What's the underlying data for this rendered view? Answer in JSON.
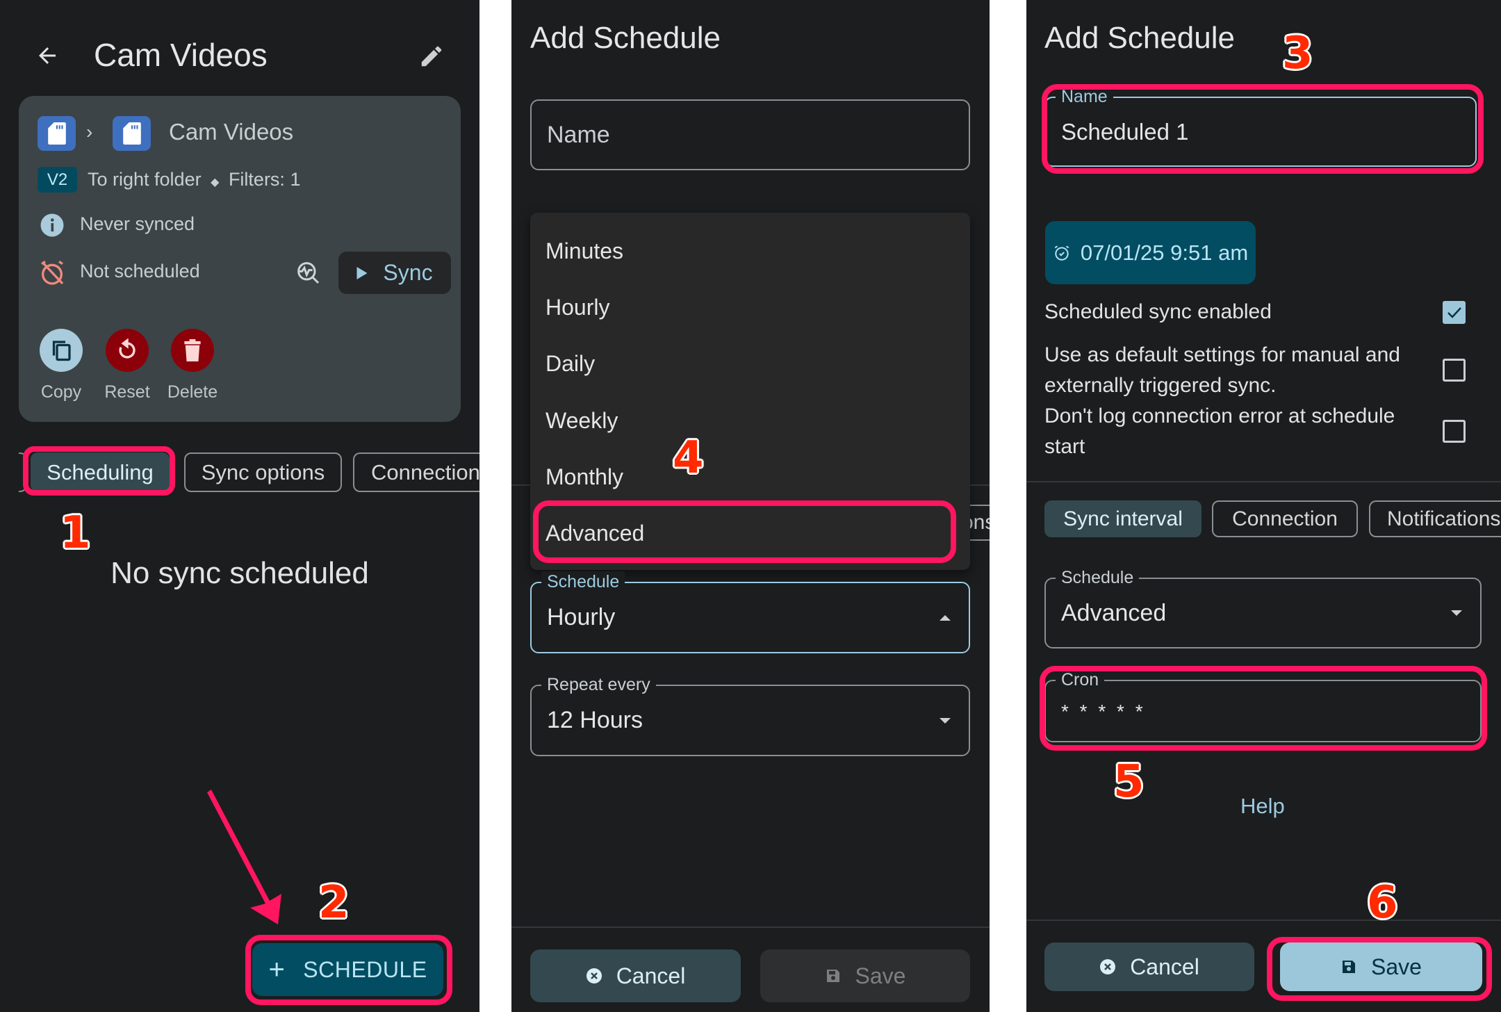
{
  "panel1": {
    "title": "Cam Videos",
    "card": {
      "folder_name": "Cam Videos",
      "version_badge": "V2",
      "direction_text": "To right folder",
      "separator": "◆",
      "filters_text": "Filters: 1",
      "last_sync_status": "Never synced",
      "schedule_status": "Not scheduled",
      "sync_button": "Sync",
      "actions": [
        {
          "label": "Copy",
          "icon": "copy-icon"
        },
        {
          "label": "Reset",
          "icon": "reset-icon"
        },
        {
          "label": "Delete",
          "icon": "delete-icon"
        }
      ]
    },
    "tabs": [
      {
        "label": "Scheduling",
        "active": true
      },
      {
        "label": "Sync options",
        "active": false
      },
      {
        "label": "Connection",
        "active": false
      }
    ],
    "empty_message": "No sync scheduled",
    "fab_label": "SCHEDULE"
  },
  "panel2": {
    "title": "Add Schedule",
    "name_placeholder": "Name",
    "schedule_options": [
      "Minutes",
      "Hourly",
      "Daily",
      "Weekly",
      "Monthly",
      "Advanced"
    ],
    "highlighted_option": "Advanced",
    "schedule_label": "Schedule",
    "schedule_value": "Hourly",
    "repeat_label": "Repeat every",
    "repeat_value": "12 Hours",
    "background_tab_fragment": "ons",
    "cancel_label": "Cancel",
    "save_label": "Save"
  },
  "panel3": {
    "title": "Add Schedule",
    "name_label": "Name",
    "name_value": "Scheduled 1",
    "start_datetime": "07/01/25 9:51 am",
    "options": [
      {
        "label": "Scheduled sync enabled",
        "checked": true
      },
      {
        "label_line1": "Use as default settings for manual and",
        "label_line2": "externally triggered sync.",
        "checked": false
      },
      {
        "label_line1": "Don't log connection error at schedule",
        "label_line2": "start",
        "checked": false
      }
    ],
    "tabs": [
      {
        "label": "Sync interval",
        "active": true
      },
      {
        "label": "Connection",
        "active": false
      },
      {
        "label": "Notifications",
        "active": false
      }
    ],
    "schedule_label": "Schedule",
    "schedule_value": "Advanced",
    "cron_label": "Cron",
    "cron_value": "* * * * *",
    "help_link": "Help",
    "cancel_label": "Cancel",
    "save_label": "Save"
  },
  "annotations": {
    "step1": "1",
    "step2": "2",
    "step3": "3",
    "step4": "4",
    "step5": "5",
    "step6": "6"
  },
  "colors": {
    "accent": "#9cc7da",
    "primary_dark": "#034d62",
    "danger": "#8b0009",
    "highlight": "#ff1560",
    "step_number": "#ff2a00"
  }
}
